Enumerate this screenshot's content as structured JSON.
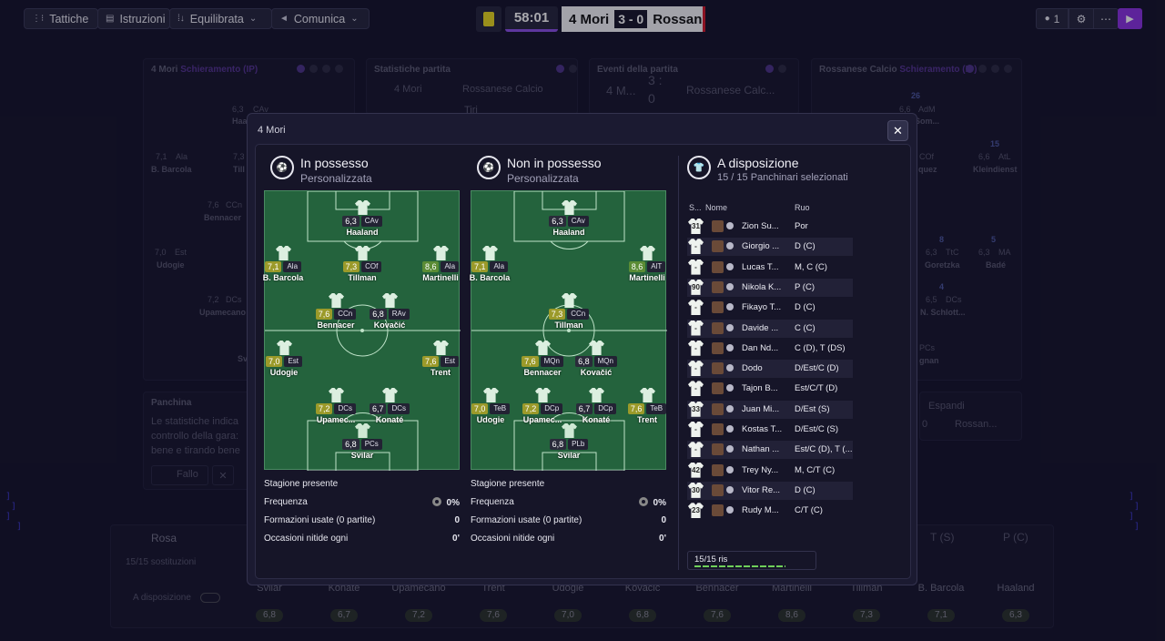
{
  "topbar": {
    "tattiche": "Tattiche",
    "istruzioni": "Istruzioni",
    "equilibrata": "Equilibrata",
    "comunica": "Comunica",
    "clock": "58:01",
    "home_team": "4 Mori",
    "score": "3 - 0",
    "away_team": "Rossan",
    "user_count": "1"
  },
  "background": {
    "p1_team": "4 Mori",
    "p1_title": "Schieramento (IP)",
    "p2_title": "Statistiche partita",
    "p2_home": "4 Mori",
    "p2_away": "Rossanese Calcio",
    "p2_row": "Tiri",
    "p3_title": "Eventi della partita",
    "p3_home": "4 M...",
    "p3_score_top": "3 :",
    "p3_score_bot": "0",
    "p3_away": "Rossanese Calc...",
    "p4_team": "Rossanese Calcio",
    "p4_title": "Schieramento (IP)",
    "left_players": [
      {
        "name": "Haa",
        "rating": "6,3",
        "role": "CAv"
      },
      {
        "name": "B. Barcola",
        "rating": "7,1",
        "role": "Ala"
      },
      {
        "name": "Till",
        "rating": "7,3",
        "role": ""
      },
      {
        "name": "Bennacer",
        "rating": "7,6",
        "role": "CCn"
      },
      {
        "name": "Udogie",
        "rating": "7,0",
        "role": "Est"
      },
      {
        "name": "Upamecano",
        "rating": "7,2",
        "role": "DCs"
      },
      {
        "name": "Svi",
        "rating": "",
        "role": ""
      }
    ],
    "right_players": [
      {
        "name": "Som...",
        "num": "26",
        "rating": "6,6",
        "role": "AdM"
      },
      {
        "name": "Kleindienst",
        "num": "15",
        "rating": "6,6",
        "role": "AtL"
      },
      {
        "name": "quez",
        "num": "",
        "rating": "",
        "role": "COf"
      },
      {
        "name": "Goretzka",
        "num": "8",
        "rating": "6,3",
        "role": "TtC"
      },
      {
        "name": "Badé",
        "num": "5",
        "rating": "6,3",
        "role": "MA"
      },
      {
        "name": "N. Schlott...",
        "num": "4",
        "rating": "6,5",
        "role": "DCs"
      },
      {
        "name": "gnan",
        "num": "",
        "rating": "",
        "role": "PCs"
      }
    ],
    "panchina": "Panchina",
    "panchina_text": [
      "Le statistiche indica",
      "controllo della gara:",
      "bene e tirando bene"
    ],
    "fallo": "Fallo",
    "espandi": "Espandi",
    "espandi_score": "0",
    "espandi_team": "Rossan...",
    "rosa": "Rosa",
    "sostituzioni": "15/15 sostituzioni",
    "a_disposizione": "A disposizione",
    "t_s": "T (S)",
    "p_c": "P (C)",
    "bottom_names": [
      "Svilar",
      "Konaté",
      "Upamecano",
      "Trent",
      "Udogie",
      "Kovačić",
      "Bennacer",
      "Martinelli",
      "Tillman",
      "B. Barcola",
      "Haaland"
    ],
    "bottom_vals": [
      "6,8",
      "6,7",
      "7,2",
      "7,6",
      "7,0",
      "6,8",
      "7,6",
      "8,6",
      "7,3",
      "7,1",
      "6,3"
    ]
  },
  "modal": {
    "title": "4 Mori",
    "in_possesso": {
      "title": "In possesso",
      "sub": "Personalizzata"
    },
    "non_possesso": {
      "title": "Non in possesso",
      "sub": "Personalizzata"
    },
    "in_players": [
      {
        "name": "Haaland",
        "rating": "6,3",
        "role": "CAv"
      },
      {
        "name": "B. Barcola",
        "rating": "7,1",
        "role": "Ala"
      },
      {
        "name": "Tillman",
        "rating": "7,3",
        "role": "COf"
      },
      {
        "name": "Martinelli",
        "rating": "8,6",
        "role": "Ala"
      },
      {
        "name": "Bennacer",
        "rating": "7,6",
        "role": "CCn"
      },
      {
        "name": "Kovačić",
        "rating": "6,8",
        "role": "RAv"
      },
      {
        "name": "Udogie",
        "rating": "7,0",
        "role": "Est"
      },
      {
        "name": "Trent",
        "rating": "7,6",
        "role": "Est"
      },
      {
        "name": "Upamec...",
        "rating": "7,2",
        "role": "DCs"
      },
      {
        "name": "Konaté",
        "rating": "6,7",
        "role": "DCs"
      },
      {
        "name": "Svilar",
        "rating": "6,8",
        "role": "PCs"
      }
    ],
    "out_players": [
      {
        "name": "Haaland",
        "rating": "6,3",
        "role": "CAv"
      },
      {
        "name": "B. Barcola",
        "rating": "7,1",
        "role": "Ala"
      },
      {
        "name": "Martinelli",
        "rating": "8,6",
        "role": "AlT"
      },
      {
        "name": "Tillman",
        "rating": "7,3",
        "role": "CCn"
      },
      {
        "name": "Bennacer",
        "rating": "7,6",
        "role": "MQn"
      },
      {
        "name": "Kovačić",
        "rating": "6,8",
        "role": "MQn"
      },
      {
        "name": "Udogie",
        "rating": "7,0",
        "role": "TeB"
      },
      {
        "name": "Upamec...",
        "rating": "7,2",
        "role": "DCp"
      },
      {
        "name": "Konaté",
        "rating": "6,7",
        "role": "DCp"
      },
      {
        "name": "Trent",
        "rating": "7,6",
        "role": "TeB"
      },
      {
        "name": "Svilar",
        "rating": "6,8",
        "role": "PLb"
      }
    ],
    "stats_in": {
      "season": "Stagione presente",
      "freq": "Frequenza",
      "freq_v": "0%",
      "form": "Formazioni usate (0 partite)",
      "form_v": "0",
      "occ": "Occasioni nitide ogni",
      "occ_v": "0'"
    },
    "stats_out": {
      "season": "Stagione presente",
      "freq": "Frequenza",
      "freq_v": "0%",
      "form": "Formazioni usate (0 partite)",
      "form_v": "0",
      "occ": "Occasioni nitide ogni",
      "occ_v": "0'"
    },
    "avail": {
      "title": "A disposizione",
      "sub": "15 / 15 Panchinari selezionati",
      "col_s": "S...",
      "col_nome": "Nome",
      "col_ruolo": "Ruo",
      "ris": "15/15 ris",
      "rows": [
        {
          "num": "31",
          "name": "Zion Su...",
          "role": "Por"
        },
        {
          "num": "-",
          "name": "Giorgio ...",
          "role": "D (C)"
        },
        {
          "num": "-",
          "name": "Lucas T...",
          "role": "M, C (C)"
        },
        {
          "num": "90",
          "name": "Nikola K...",
          "role": "P (C)"
        },
        {
          "num": "-",
          "name": "Fikayo T...",
          "role": "D (C)"
        },
        {
          "num": "-",
          "name": "Davide ...",
          "role": "C (C)"
        },
        {
          "num": "-",
          "name": "Dan Nd...",
          "role": "C (D), T (DS)"
        },
        {
          "num": "-",
          "name": "Dodo",
          "role": "D/Est/C (D)"
        },
        {
          "num": "-",
          "name": "Tajon B...",
          "role": "Est/C/T (D)"
        },
        {
          "num": "33",
          "name": "Juan Mi...",
          "role": "D/Est (S)"
        },
        {
          "num": "-",
          "name": "Kostas T...",
          "role": "D/Est/C (S)"
        },
        {
          "num": "-",
          "name": "Nathan ...",
          "role": "Est/C (D), T (..."
        },
        {
          "num": "42",
          "name": "Trey Ny...",
          "role": "M, C/T (C)"
        },
        {
          "num": "30",
          "name": "Vitor Re...",
          "role": "D (C)"
        },
        {
          "num": "23",
          "name": "Rudy M...",
          "role": "C/T (C)"
        }
      ]
    }
  },
  "colors": {
    "accent": "#8a32e0",
    "pitch": "#24633d",
    "score_red": "#d21a2a"
  },
  "icons": [
    "tactics-icon",
    "clipboard-icon",
    "formation-icon",
    "chevron-down-icon",
    "megaphone-icon",
    "person-icon",
    "gear-icon",
    "more-icon",
    "play-icon",
    "close-icon",
    "ball-icon",
    "shirt-icon"
  ]
}
